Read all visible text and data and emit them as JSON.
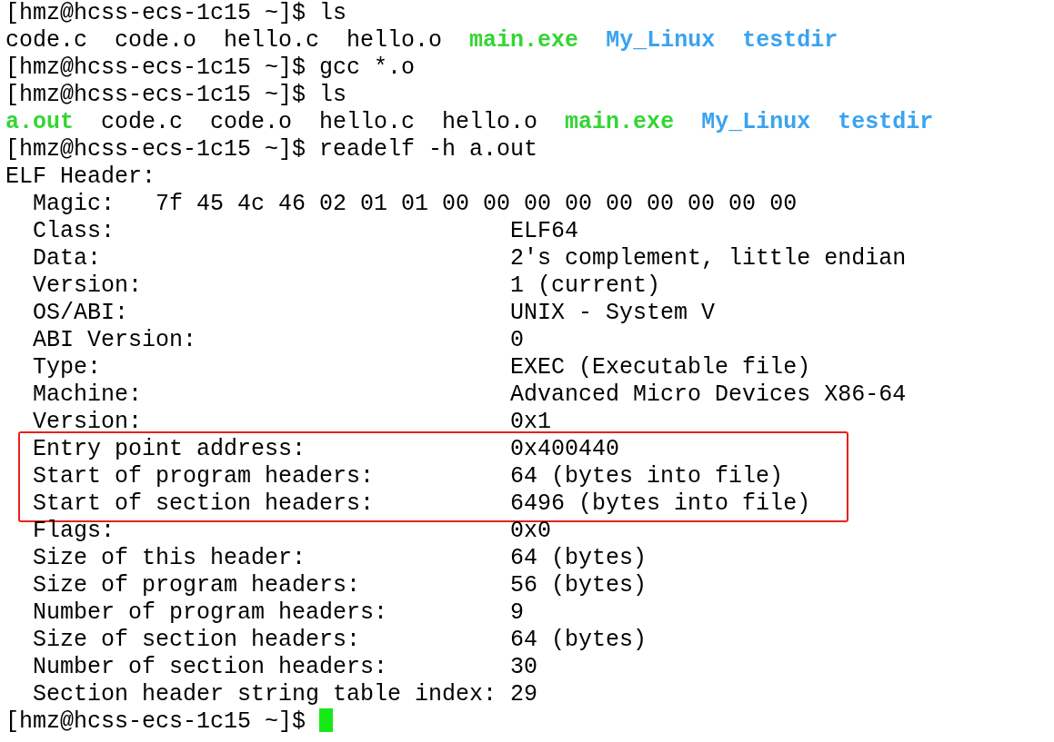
{
  "terminal": {
    "lines": [
      {
        "kind": "prompt",
        "prompt": "[hmz@hcss-ecs-1c15 ~]$",
        "command": "ls"
      },
      {
        "kind": "files",
        "files": [
          {
            "name": "code.c",
            "color": "#000000",
            "bold": false
          },
          {
            "name": "code.o",
            "color": "#000000",
            "bold": false
          },
          {
            "name": "hello.c",
            "color": "#000000",
            "bold": false
          },
          {
            "name": "hello.o",
            "color": "#000000",
            "bold": false
          },
          {
            "name": "main.exe",
            "color": "#33d633",
            "bold": true
          },
          {
            "name": "My_Linux",
            "color": "#3aa3f0",
            "bold": true
          },
          {
            "name": "testdir",
            "color": "#3aa3f0",
            "bold": true
          }
        ]
      },
      {
        "kind": "prompt",
        "prompt": "[hmz@hcss-ecs-1c15 ~]$",
        "command": "gcc *.o"
      },
      {
        "kind": "prompt",
        "prompt": "[hmz@hcss-ecs-1c15 ~]$",
        "command": "ls"
      },
      {
        "kind": "files",
        "files": [
          {
            "name": "a.out",
            "color": "#33d633",
            "bold": true
          },
          {
            "name": "code.c",
            "color": "#000000",
            "bold": false
          },
          {
            "name": "code.o",
            "color": "#000000",
            "bold": false
          },
          {
            "name": "hello.c",
            "color": "#000000",
            "bold": false
          },
          {
            "name": "hello.o",
            "color": "#000000",
            "bold": false
          },
          {
            "name": "main.exe",
            "color": "#33d633",
            "bold": true
          },
          {
            "name": "My_Linux",
            "color": "#3aa3f0",
            "bold": true
          },
          {
            "name": "testdir",
            "color": "#3aa3f0",
            "bold": true
          }
        ]
      },
      {
        "kind": "prompt",
        "prompt": "[hmz@hcss-ecs-1c15 ~]$",
        "command": "readelf -h a.out"
      },
      {
        "kind": "text",
        "text": "ELF Header:"
      },
      {
        "kind": "magic",
        "label": "Magic:",
        "value": "7f 45 4c 46 02 01 01 00 00 00 00 00 00 00 00 00"
      },
      {
        "kind": "field",
        "label": "Class:",
        "value": "ELF64",
        "highlighted": false
      },
      {
        "kind": "field",
        "label": "Data:",
        "value": "2's complement, little endian",
        "highlighted": false
      },
      {
        "kind": "field",
        "label": "Version:",
        "value": "1 (current)",
        "highlighted": false
      },
      {
        "kind": "field",
        "label": "OS/ABI:",
        "value": "UNIX - System V",
        "highlighted": false
      },
      {
        "kind": "field",
        "label": "ABI Version:",
        "value": "0",
        "highlighted": false
      },
      {
        "kind": "field",
        "label": "Type:",
        "value": "EXEC (Executable file)",
        "highlighted": false
      },
      {
        "kind": "field",
        "label": "Machine:",
        "value": "Advanced Micro Devices X86-64",
        "highlighted": false
      },
      {
        "kind": "field",
        "label": "Version:",
        "value": "0x1",
        "highlighted": false
      },
      {
        "kind": "field",
        "label": "Entry point address:",
        "value": "0x400440",
        "highlighted": true
      },
      {
        "kind": "field",
        "label": "Start of program headers:",
        "value": "64 (bytes into file)",
        "highlighted": true
      },
      {
        "kind": "field",
        "label": "Start of section headers:",
        "value": "6496 (bytes into file)",
        "highlighted": true
      },
      {
        "kind": "field",
        "label": "Flags:",
        "value": "0x0",
        "highlighted": false
      },
      {
        "kind": "field",
        "label": "Size of this header:",
        "value": "64 (bytes)",
        "highlighted": false
      },
      {
        "kind": "field",
        "label": "Size of program headers:",
        "value": "56 (bytes)",
        "highlighted": false
      },
      {
        "kind": "field",
        "label": "Number of program headers:",
        "value": "9",
        "highlighted": false
      },
      {
        "kind": "field",
        "label": "Size of section headers:",
        "value": "64 (bytes)",
        "highlighted": false
      },
      {
        "kind": "field",
        "label": "Number of section headers:",
        "value": "30",
        "highlighted": false
      },
      {
        "kind": "field",
        "label": "Section header string table index:",
        "value": "29",
        "highlighted": false
      },
      {
        "kind": "cursor",
        "prompt": "[hmz@hcss-ecs-1c15 ~]$"
      }
    ]
  }
}
